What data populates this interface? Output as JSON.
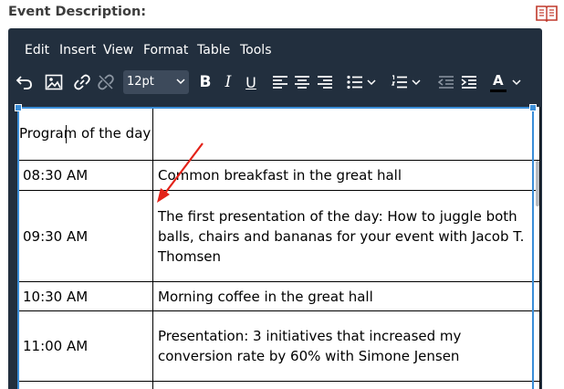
{
  "field": {
    "label": "Event Description:",
    "help_icon": "book-icon"
  },
  "menubar": {
    "items": [
      "Edit",
      "Insert",
      "View",
      "Format",
      "Table",
      "Tools"
    ]
  },
  "toolbar": {
    "font_size": "12pt",
    "bold_label": "B",
    "italic_label": "I",
    "underline_label": "U",
    "text_color_label": "A"
  },
  "table": {
    "header": {
      "time": "Program of the day",
      "desc": ""
    },
    "rows": [
      {
        "time": "08:30 AM",
        "desc": "Common breakfast in the great hall"
      },
      {
        "time": "09:30 AM",
        "desc": "The first presentation of the day: How to juggle both balls, chairs and bananas for your event with Jacob T. Thomsen"
      },
      {
        "time": "10:30 AM",
        "desc": "Morning coffee in the great hall"
      },
      {
        "time": "11:00 AM",
        "desc": "Presentation: 3 initiatives that increased my conversion rate by 60% with Simone Jensen"
      }
    ]
  },
  "colors": {
    "editor_bg": "#222f3e",
    "selection": "#3b8ed8",
    "annotation_arrow": "#e32219",
    "help_icon": "#c0392b"
  }
}
